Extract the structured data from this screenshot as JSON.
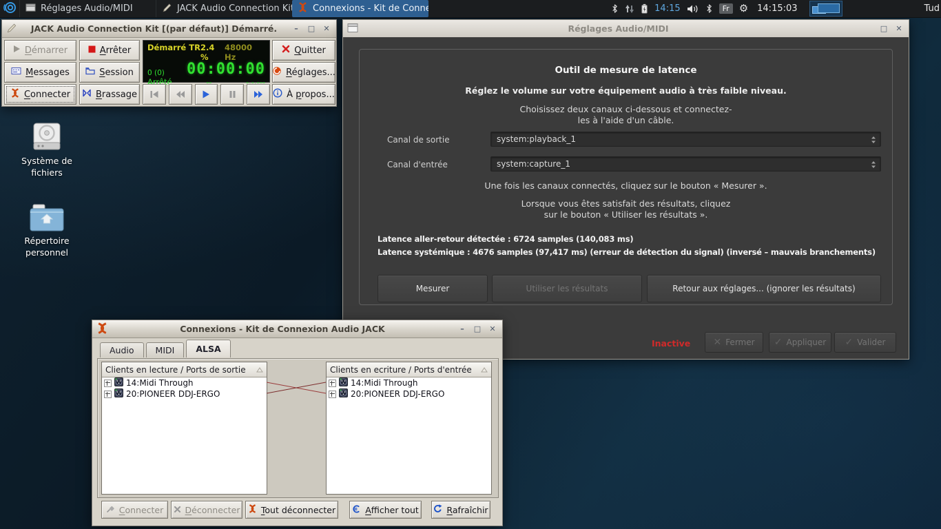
{
  "colors": {
    "taskbar-active": "#2e5f91",
    "jack-orange": "#cd4a12",
    "display-yellow": "#d8d428",
    "display-dim-yellow": "#8f8c1e",
    "display-green": "#30e030",
    "status-red": "#d02a2a",
    "play-blue": "#2b63d9"
  },
  "glyphs": {
    "minimize": "–",
    "maximize": "□",
    "close": "✕",
    "gear": "⚙",
    "check": "✓",
    "cross": "✕"
  },
  "taskbar": {
    "apps": [
      {
        "label": "Réglages Audio/MIDI",
        "icon": "window-icon"
      },
      {
        "label": "JACK Audio Connection Kit...",
        "icon": "pen-icon"
      },
      {
        "label": "Connexions - Kit de Conne...",
        "icon": "jack-logo-icon"
      }
    ],
    "tray": {
      "time_short": "14:15",
      "keyboard_layout": "Fr",
      "clock": "14:15:03",
      "username": "Tud"
    }
  },
  "desktop": {
    "icons": [
      {
        "label": "Système de fichiers",
        "icon": "hard-drive-icon"
      },
      {
        "label": "Répertoire personnel",
        "icon": "home-folder-icon"
      }
    ]
  },
  "jack": {
    "title": "JACK Audio Connection Kit [(par défaut)] Démarré.",
    "buttons": {
      "start": "&Démarrer",
      "stop": "&Arrêter",
      "messages": "&Messages",
      "session": "&Session",
      "connect": "&Connecter",
      "patchbay": "&Brassage",
      "quit": "&Quitter",
      "settings": "&Réglages...",
      "about": "À &propos..."
    },
    "display": {
      "status": "Démarré",
      "transport_flag": "TR",
      "dsp_load": "2.4 %",
      "sample_rate": "48000 Hz",
      "xruns": "0 (0)",
      "clock": "00:00:00",
      "transport_state": "Arrêté",
      "bbt": "--",
      "transport_time": "-.-.---"
    }
  },
  "settings": {
    "title": "Réglages Audio/MIDI",
    "heading": "Outil de mesure de latence",
    "volume_note": "Réglez le volume sur votre équipement audio à très faible niveau.",
    "choose_line1": "Choisissez deux canaux ci-dessous et connectez-",
    "choose_line2": "les à l'aide d'un câble.",
    "output_label": "Canal de sortie",
    "output_value": "system:playback_1",
    "input_label": "Canal d'entrée",
    "input_value": "system:capture_1",
    "measure_note": "Une fois les canaux connectés, cliquez sur le bouton « Mesurer ».",
    "satisfied_line1": "Lorsque vous êtes satisfait des résultats, cliquez",
    "satisfied_line2": "sur le bouton « Utiliser les résultats ».",
    "result_line1": "Latence aller-retour détectée : 6724 samples (140,083 ms)",
    "result_line2": "Latence systémique : 4676 samples (97,417 ms) (erreur de détection du signal) (inversé – mauvais branchements)",
    "measure_button": "Mesurer",
    "use_results_button": "Utiliser les résultats",
    "back_button": "Retour aux réglages... (ignorer les résultats)",
    "status": "Inactive",
    "close_button": "Fermer",
    "apply_button": "Appliquer",
    "ok_button": "Valider"
  },
  "connections": {
    "title": "Connexions - Kit de Connexion Audio JACK",
    "tabs": [
      {
        "label": "Audio"
      },
      {
        "label": "MIDI"
      },
      {
        "label": "ALSA"
      }
    ],
    "readable_header": "Clients en lecture / Ports de sortie",
    "writable_header": "Clients en ecriture / Ports d'entrée",
    "clients": [
      {
        "label": "14:Midi Through"
      },
      {
        "label": "20:PIONEER DDJ-ERGO"
      }
    ],
    "connect_button": "&Connecter",
    "disconnect_button": "&Déconnecter",
    "disconnect_all_button": "&Tout déconnecter",
    "show_all_button": "&Afficher tout",
    "refresh_button": "&Rafraîchir"
  }
}
